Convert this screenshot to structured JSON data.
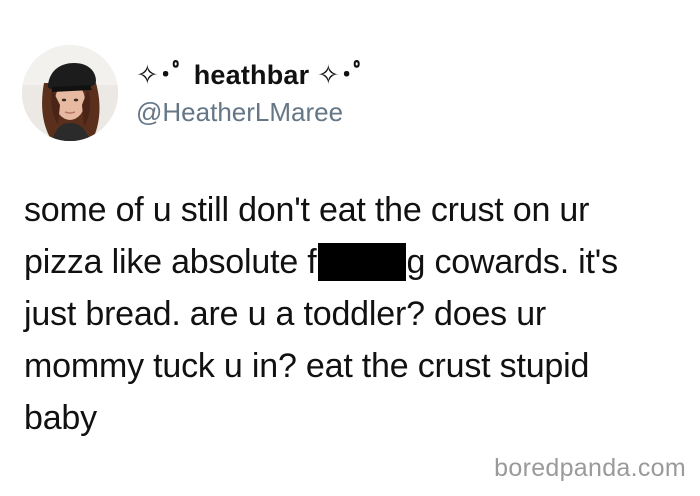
{
  "tweet": {
    "display_name": "✧･ﾟ heathbar ✧･ﾟ",
    "handle": "@HeatherLMaree",
    "avatar_icon": "profile-photo",
    "text": {
      "line1": "some of u still don't eat the crust on ur",
      "line2_before": "pizza like absolute f",
      "line2_after": "g cowards. it's",
      "line3": "just bread. are u a toddler? does ur",
      "line4": "mommy tuck u in? eat the crust stupid",
      "line5": "baby"
    },
    "redaction_color": "#000000"
  },
  "watermark": {
    "text": "boredpanda.com"
  }
}
